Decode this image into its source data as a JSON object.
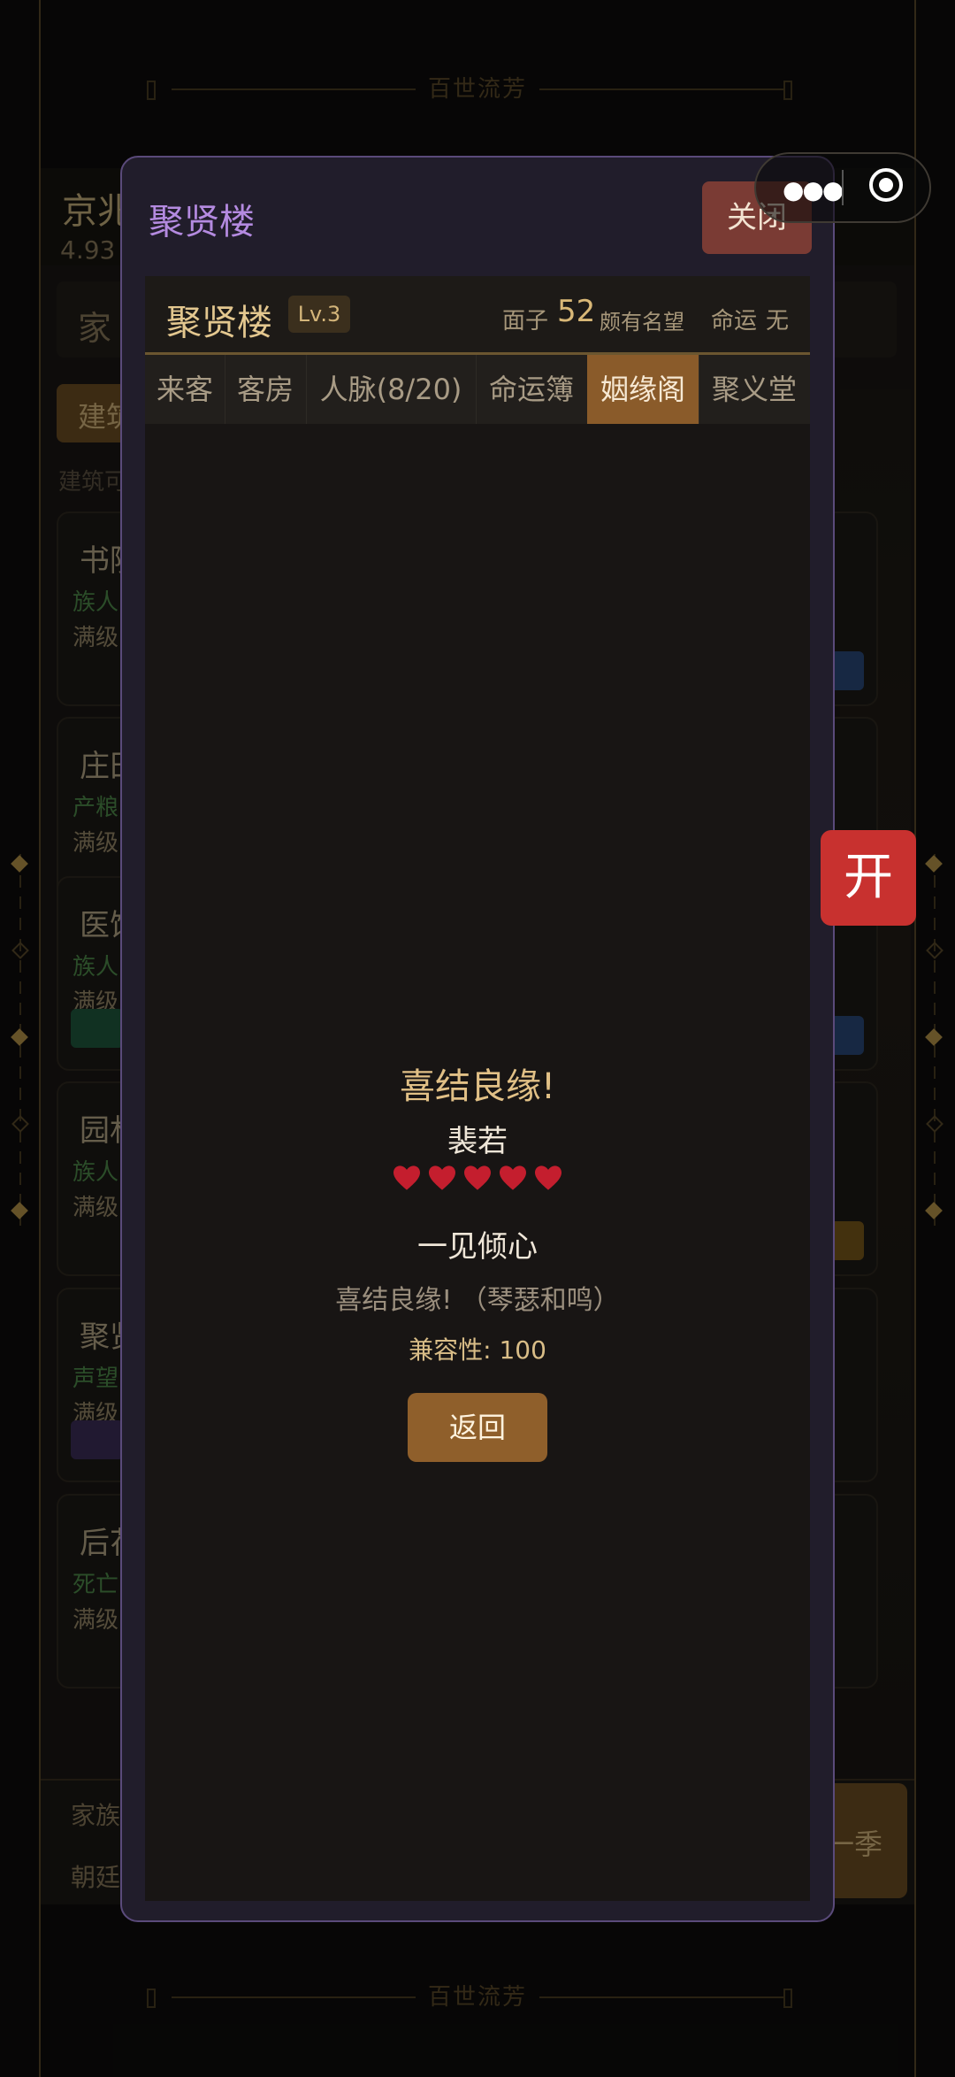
{
  "app": {
    "banner_text": "百世流芳"
  },
  "background_page": {
    "title": "京兆",
    "subtitle": "4.93",
    "tab_partial": "家",
    "build_chip": "建筑",
    "hint": "建筑可",
    "cards": [
      {
        "title": "书院",
        "green": "族人",
        "level": "满级"
      },
      {
        "title": "庄田",
        "green": "产粮",
        "level": "满级"
      },
      {
        "title": "医馆",
        "green": "族人",
        "level": "满级"
      },
      {
        "title": "园林",
        "green": "族人",
        "level": "满级"
      },
      {
        "title": "聚贤",
        "green": "声望",
        "level": "满级"
      },
      {
        "title": "后花",
        "green": "死亡",
        "level": "满级"
      }
    ],
    "bottom_line1": "家族",
    "bottom_line2": "朝廷",
    "next_button": "一季"
  },
  "floating": {
    "open_button": "开"
  },
  "capsule": {
    "menu_icon": "more-dots-icon",
    "close_icon": "target-circle-icon"
  },
  "modal": {
    "title": "聚贤楼",
    "close_label": "关闭",
    "header": {
      "name": "聚贤楼",
      "level": "Lv.3",
      "face_label": "面子",
      "face_value": "52",
      "face_desc": "颇有名望",
      "fate_label": "命运",
      "fate_value": "无"
    },
    "tabs": [
      {
        "label": "来客",
        "active": false
      },
      {
        "label": "客房",
        "active": false
      },
      {
        "label": "人脉(8/20)",
        "active": false
      },
      {
        "label": "命运簿",
        "active": false
      },
      {
        "label": "姻缘阁",
        "active": true
      },
      {
        "label": "聚义堂",
        "active": false
      }
    ],
    "result": {
      "title": "喜结良缘!",
      "name": "裴若",
      "hearts": 5,
      "heart_color": "#c41e2e",
      "level_text": "一见倾心",
      "description": "喜结良缘! （琴瑟和鸣）",
      "compatibility": "兼容性: 100",
      "back_label": "返回"
    }
  },
  "colors": {
    "accent_purple": "#b48ae0",
    "gold": "#e1c086",
    "active_tab": "#8a5b2a",
    "close_button": "#7a3b34",
    "open_button": "#c8312f"
  }
}
